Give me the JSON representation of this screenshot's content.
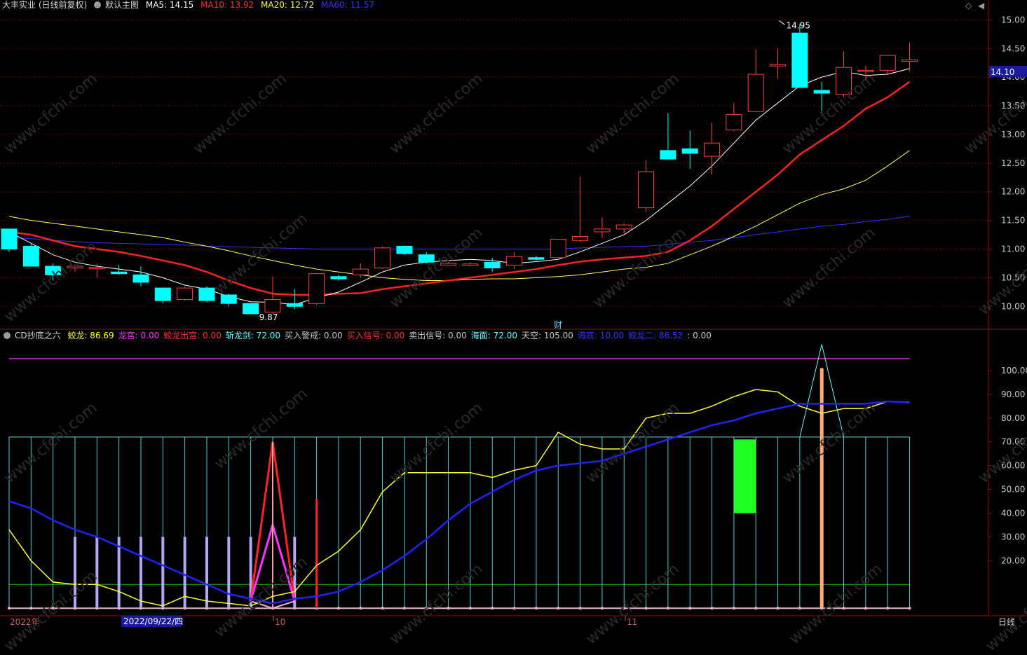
{
  "main_header": {
    "stock_name": "大丰实业 (日线前复权)",
    "template": "默认主图",
    "ma5": {
      "label": "MA5:",
      "value": "14.15",
      "color": "#ffffff"
    },
    "ma10": {
      "label": "MA10:",
      "value": "13.92",
      "color": "#ff3333"
    },
    "ma20": {
      "label": "MA20:",
      "value": "12.72",
      "color": "#ffff33"
    },
    "ma60": {
      "label": "MA60:",
      "value": "11.57",
      "color": "#3333ff"
    }
  },
  "sub_header": {
    "indicator": "CD抄底之六",
    "items": [
      {
        "label": "蛟龙:",
        "value": "86.69",
        "color": "#ffff33"
      },
      {
        "label": "龙宫:",
        "value": "0.00",
        "color": "#ff33ff"
      },
      {
        "label": "蛟龙出宫:",
        "value": "0.00",
        "color": "#ff3333"
      },
      {
        "label": "斩龙剑:",
        "value": "72.00",
        "color": "#66ffff"
      },
      {
        "label": "买入警戒:",
        "value": "0.00",
        "color": "#c8c8c8"
      },
      {
        "label": "买入信号:",
        "value": "0.00",
        "color": "#ff3333"
      },
      {
        "label": "卖出信号:",
        "value": "0.00",
        "color": "#c8c8c8"
      },
      {
        "label": "海面:",
        "value": "72.00",
        "color": "#66ffff"
      },
      {
        "label": "天空:",
        "value": "105.00",
        "color": "#c8c8c8"
      },
      {
        "label": "海底:",
        "value": "10.00",
        "color": "#3333ff"
      },
      {
        "label": "蛟龙二:",
        "value": "86.52",
        "color": "#3333ff"
      },
      {
        "label": ":",
        "value": "0.00",
        "color": "#c8c8c8"
      }
    ]
  },
  "price_tag": "14.10",
  "high_marker": "14.95",
  "low_marker": "9.87",
  "event_marker": "财",
  "period_label": "日线",
  "watermark": "www.cfchi.com",
  "chart_data": [
    {
      "type": "candlestick",
      "yaxis_ticks": [
        "15.00",
        "14.50",
        "14.00",
        "13.50",
        "13.00",
        "12.50",
        "12.00",
        "11.50",
        "11.00",
        "10.50",
        "10.00"
      ],
      "ylim": [
        9.6,
        15.2
      ],
      "candles": [
        [
          11.35,
          11.0,
          11.35,
          10.95
        ],
        [
          11.05,
          10.7,
          11.1,
          10.7
        ],
        [
          10.7,
          10.55,
          10.75,
          10.45
        ],
        [
          10.67,
          10.7,
          10.72,
          10.6
        ],
        [
          10.67,
          10.68,
          10.75,
          10.5
        ],
        [
          10.6,
          10.57,
          10.72,
          10.55
        ],
        [
          10.55,
          10.42,
          10.7,
          10.35
        ],
        [
          10.32,
          10.1,
          10.33,
          10.05
        ],
        [
          10.12,
          10.32,
          10.35,
          10.1
        ],
        [
          10.32,
          10.1,
          10.35,
          10.07
        ],
        [
          10.2,
          10.05,
          10.22,
          10.0
        ],
        [
          10.05,
          9.87,
          10.05,
          9.87
        ],
        [
          9.9,
          10.12,
          10.52,
          9.87
        ],
        [
          10.05,
          10.0,
          10.3,
          9.95
        ],
        [
          10.05,
          10.57,
          10.58,
          10.02
        ],
        [
          10.52,
          10.48,
          10.55,
          10.45
        ],
        [
          10.55,
          10.65,
          10.75,
          10.5
        ],
        [
          10.67,
          11.02,
          11.05,
          10.65
        ],
        [
          11.05,
          10.92,
          11.06,
          10.9
        ],
        [
          10.9,
          10.77,
          10.95,
          10.75
        ],
        [
          10.72,
          10.75,
          10.77,
          10.72
        ],
        [
          10.72,
          10.74,
          10.76,
          10.7
        ],
        [
          10.77,
          10.67,
          10.85,
          10.6
        ],
        [
          10.72,
          10.87,
          10.95,
          10.65
        ],
        [
          10.85,
          10.82,
          10.88,
          10.8
        ],
        [
          10.85,
          11.17,
          11.18,
          10.85
        ],
        [
          11.15,
          11.22,
          12.27,
          11.12
        ],
        [
          11.3,
          11.35,
          11.55,
          11.2
        ],
        [
          11.35,
          11.42,
          11.45,
          11.25
        ],
        [
          11.72,
          12.35,
          12.55,
          11.65
        ],
        [
          12.72,
          12.57,
          13.37,
          12.57
        ],
        [
          12.75,
          12.67,
          13.07,
          12.4
        ],
        [
          12.62,
          12.85,
          13.2,
          12.3
        ],
        [
          13.08,
          13.35,
          13.55,
          13.05
        ],
        [
          13.4,
          14.05,
          14.48,
          13.4
        ],
        [
          14.22,
          14.22,
          14.5,
          13.97
        ],
        [
          14.77,
          13.82,
          14.93,
          13.82
        ],
        [
          13.77,
          13.72,
          13.92,
          13.35
        ],
        [
          13.7,
          14.17,
          14.45,
          13.65
        ],
        [
          14.1,
          14.12,
          14.2,
          13.95
        ],
        [
          14.12,
          14.38,
          14.38,
          14.05
        ],
        [
          14.3,
          14.3,
          14.6,
          14.1
        ]
      ],
      "candle_colors": {
        "up": "#ff4040",
        "down": "#00ffff"
      },
      "ma5": [
        11.3,
        11.1,
        10.9,
        10.77,
        10.7,
        10.65,
        10.6,
        10.5,
        10.37,
        10.3,
        10.17,
        10.08,
        10.07,
        10.03,
        10.15,
        10.25,
        10.42,
        10.6,
        10.72,
        10.77,
        10.8,
        10.82,
        10.8,
        10.75,
        10.78,
        10.82,
        10.95,
        11.1,
        11.25,
        11.5,
        11.8,
        12.1,
        12.45,
        12.85,
        13.25,
        13.55,
        13.85,
        14.0,
        14.1,
        14.03,
        14.05,
        14.15
      ],
      "ma10": [
        11.3,
        11.25,
        11.15,
        11.05,
        11.0,
        10.95,
        10.88,
        10.8,
        10.72,
        10.6,
        10.45,
        10.32,
        10.22,
        10.2,
        10.2,
        10.22,
        10.23,
        10.3,
        10.35,
        10.4,
        10.45,
        10.5,
        10.55,
        10.6,
        10.65,
        10.72,
        10.78,
        10.82,
        10.85,
        10.88,
        10.95,
        11.15,
        11.4,
        11.7,
        12.0,
        12.3,
        12.65,
        12.9,
        13.15,
        13.45,
        13.65,
        13.92
      ],
      "ma20": [
        11.57,
        11.5,
        11.45,
        11.4,
        11.35,
        11.3,
        11.25,
        11.2,
        11.12,
        11.05,
        10.97,
        10.88,
        10.8,
        10.72,
        10.65,
        10.6,
        10.55,
        10.5,
        10.47,
        10.45,
        10.45,
        10.47,
        10.48,
        10.48,
        10.5,
        10.52,
        10.55,
        10.6,
        10.65,
        10.68,
        10.75,
        10.9,
        11.05,
        11.22,
        11.4,
        11.6,
        11.8,
        11.95,
        12.05,
        12.2,
        12.45,
        12.72
      ],
      "ma60": [
        11.2,
        11.18,
        11.15,
        11.13,
        11.11,
        11.1,
        11.09,
        11.08,
        11.07,
        11.05,
        11.04,
        11.03,
        11.02,
        11.01,
        11.0,
        11.0,
        11.0,
        11.0,
        11.0,
        11.0,
        11.0,
        11.0,
        11.0,
        11.0,
        11.0,
        11.0,
        11.02,
        11.03,
        11.04,
        11.05,
        11.08,
        11.12,
        11.15,
        11.2,
        11.25,
        11.3,
        11.35,
        11.4,
        11.43,
        11.48,
        11.52,
        11.57
      ]
    },
    {
      "type": "line",
      "yaxis_ticks": [
        "100.00",
        "90.00",
        "80.00",
        "70.00",
        "60.00",
        "50.00",
        "40.00",
        "30.00",
        "20.00"
      ],
      "ylim": [
        -2,
        115
      ],
      "x": [
        "2022年",
        "2022/09/22/四",
        "10",
        "11"
      ],
      "series": [
        {
          "name": "蛟龙",
          "color": "#ffff33",
          "values": [
            33,
            20,
            11,
            10,
            10,
            7,
            3,
            1,
            5,
            3,
            2,
            1,
            5,
            7,
            18,
            24,
            33,
            49,
            57,
            57,
            57,
            57,
            55,
            58,
            60,
            74,
            69,
            67,
            67,
            80,
            82,
            82,
            85,
            89,
            92,
            91,
            85,
            82,
            84,
            84,
            87,
            86.69
          ]
        },
        {
          "name": "蛟龙二",
          "color": "#2222ff",
          "values": [
            45,
            42,
            37,
            33,
            30,
            26,
            22,
            18,
            14,
            10,
            6,
            4,
            2,
            4,
            5,
            7,
            11,
            16,
            22,
            29,
            37,
            44,
            49,
            54,
            58,
            60,
            61,
            62,
            65,
            68,
            71,
            74,
            77,
            79,
            82,
            84,
            86,
            86,
            86,
            86,
            87,
            86.52
          ]
        },
        {
          "name": "斩龙剑",
          "color": "#66ffff",
          "values": [
            72
          ]
        },
        {
          "name": "天空",
          "color": "#ff33ff",
          "values": [
            105
          ]
        },
        {
          "name": "海底",
          "color": "#33cc33",
          "values": [
            10
          ]
        }
      ],
      "bars_lavender": [
        3,
        4,
        5,
        6,
        7,
        8,
        9,
        10,
        11,
        13
      ],
      "spike_red_index": 12,
      "spike_height": 70,
      "spike_magenta_height": 35,
      "red_bar_index": 14,
      "red_bar_height": 46,
      "green_box": {
        "from_index": 33,
        "to_index": 34,
        "low": 40,
        "high": 71
      },
      "orange_bar_index": 37,
      "orange_bar_height": 101,
      "cyan_spike_height": 111
    }
  ]
}
